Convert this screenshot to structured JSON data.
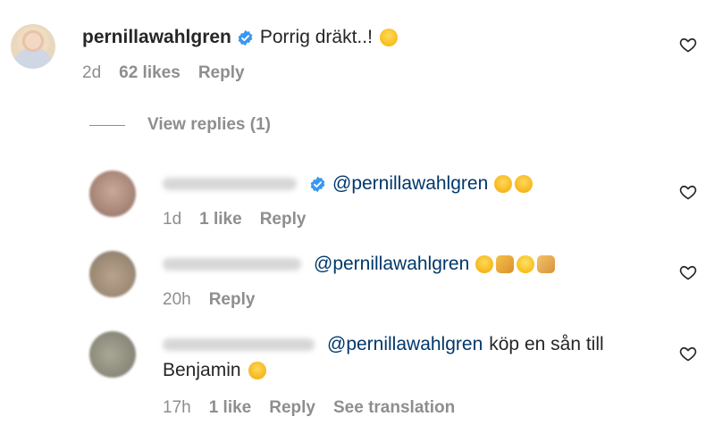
{
  "comment": {
    "username": "pernillawahlgren",
    "text": "Porrig dräkt..!",
    "emoji": [
      "grinning-sweat"
    ],
    "time": "2d",
    "likes": "62 likes",
    "reply_label": "Reply"
  },
  "view_replies_label": "View replies (1)",
  "replies": [
    {
      "mention": "@pernillawahlgren",
      "time": "1d",
      "likes": "1 like",
      "reply_label": "Reply"
    },
    {
      "mention": "@pernillawahlgren",
      "time": "20h",
      "reply_label": "Reply"
    },
    {
      "mention": "@pernillawahlgren",
      "text": "köp en sån till",
      "text2": "Benjamin",
      "time": "17h",
      "likes": "1 like",
      "reply_label": "Reply",
      "translate_label": "See translation"
    }
  ],
  "colors": {
    "verified": "#3897f0",
    "mention": "#00376b",
    "meta": "#8e8e8e"
  }
}
